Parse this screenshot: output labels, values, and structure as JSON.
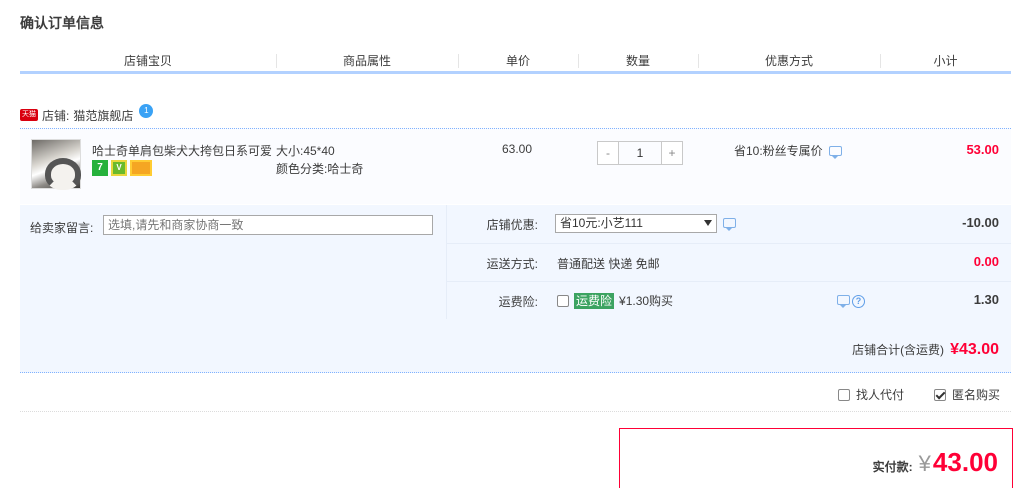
{
  "page": {
    "title": "确认订单信息"
  },
  "columns": [
    "店铺宝贝",
    "商品属性",
    "单价",
    "数量",
    "优惠方式",
    "小计"
  ],
  "shop": {
    "badge": "天猫",
    "label": "店铺:",
    "name": "猫范旗舰店",
    "chat_badge": "1"
  },
  "item": {
    "title": "哈士奇单肩包柴犬大挎包日系可爱",
    "badges": [
      "7",
      "V"
    ],
    "attr_size": "大小:45*40",
    "attr_color": "颜色分类:哈士奇",
    "unit_price": "63.00",
    "quantity": "1",
    "qty_minus": "-",
    "qty_plus": "+",
    "promo": "省10:粉丝专属价",
    "subtotal": "53.00"
  },
  "message": {
    "label": "给卖家留言:",
    "placeholder": "选填,请先和商家协商一致"
  },
  "shop_discount": {
    "label": "店铺优惠:",
    "selected": "省10元:小艺111",
    "value": "-10.00"
  },
  "shipping": {
    "label": "运送方式:",
    "text": "普通配送 快递 免邮",
    "value": "0.00"
  },
  "insurance": {
    "label": "运费险:",
    "tag": "运费险",
    "price": "¥1.30购买",
    "value": "1.30",
    "checked": false,
    "help": "?"
  },
  "shop_total": {
    "label": "店铺合计(含运费)",
    "value": "¥43.00"
  },
  "options": {
    "pay_for_me": "找人代付",
    "pay_for_me_checked": false,
    "anonymous": "匿名购买",
    "anonymous_checked": true
  },
  "payment": {
    "label": "实付款:",
    "currency": "¥",
    "amount": "43.00"
  },
  "colors": {
    "accent_red": "#ff0036",
    "header_line": "#b2d1ff",
    "panel_bg": "#f2f7ff"
  }
}
